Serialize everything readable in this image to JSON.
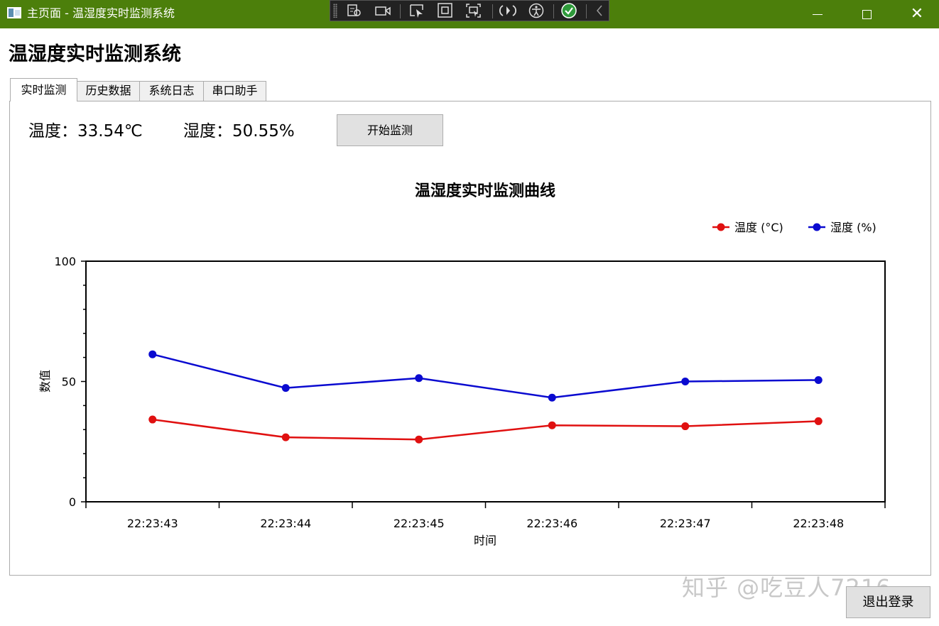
{
  "window": {
    "title": "主页面 - 温湿度实时监测系统",
    "minimize_icon": "minimize-icon",
    "maximize_icon": "maximize-icon",
    "close_icon": "close-icon",
    "close_glyph": "✕",
    "titlebar_color": "#4c7f0b"
  },
  "debug_toolbar": {
    "icons": [
      "live-visual-tree-icon",
      "record-icon",
      "select-element-icon",
      "display-layout-adorners-icon",
      "track-focus-icon",
      "hot-reload-icon",
      "accessibility-icon",
      "binding-ok-icon",
      "collapse-chevron-icon"
    ]
  },
  "header": {
    "title": "温湿度实时监测系统"
  },
  "tabs": [
    {
      "label": "实时监测",
      "active": true
    },
    {
      "label": "历史数据",
      "active": false
    },
    {
      "label": "系统日志",
      "active": false
    },
    {
      "label": "串口助手",
      "active": false
    }
  ],
  "readings": {
    "temperature": "温度：33.54℃",
    "humidity": "湿度：50.55%"
  },
  "start_button": {
    "label": "开始监测"
  },
  "chart_data": {
    "type": "line",
    "title": "温湿度实时监测曲线",
    "xlabel": "时间",
    "ylabel": "数值",
    "categories": [
      "22:23:43",
      "22:23:44",
      "22:23:45",
      "22:23:46",
      "22:23:47",
      "22:23:48"
    ],
    "yticks": [
      "0",
      "50",
      "100"
    ],
    "ylim": [
      0,
      100
    ],
    "legend_position": "top-right",
    "grid": false,
    "series": [
      {
        "name": "温度 (°C)",
        "color": "#e01010",
        "values": [
          34.2,
          26.8,
          25.9,
          31.8,
          31.4,
          33.5
        ]
      },
      {
        "name": "湿度 (%)",
        "color": "#0a0ad0",
        "values": [
          61.3,
          47.3,
          51.4,
          43.3,
          50.0,
          50.6
        ]
      }
    ]
  },
  "watermark": "知乎 @吃豆人7216",
  "logout_button": {
    "label": "退出登录"
  }
}
